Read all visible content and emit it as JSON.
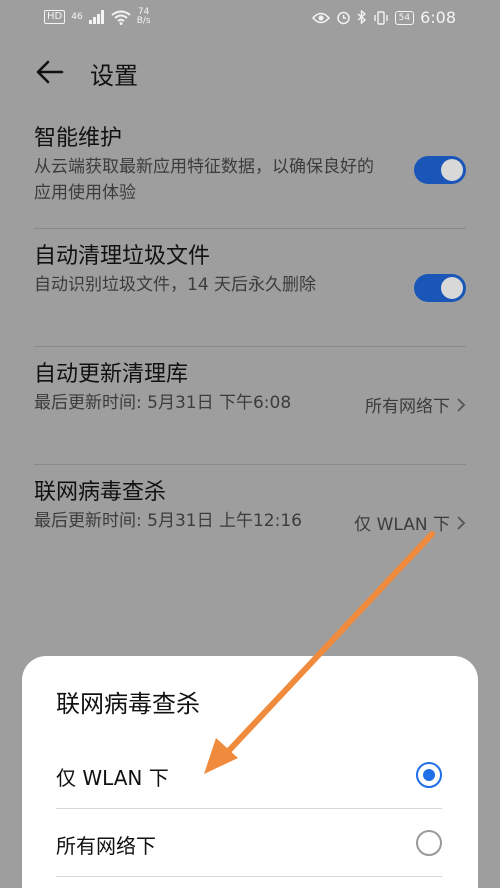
{
  "status_bar": {
    "left_badge": "HD",
    "network": "46",
    "speed_value": "74",
    "speed_unit": "B/s",
    "battery": "54",
    "time": "6:08"
  },
  "header": {
    "title": "设置"
  },
  "items": [
    {
      "title": "智能维护",
      "subtitle": "从云端获取最新应用特征数据，以确保良好的应用使用体验",
      "toggle_on": true
    },
    {
      "title": "自动清理垃圾文件",
      "subtitle": "自动识别垃圾文件，14 天后永久删除",
      "toggle_on": true
    },
    {
      "title": "自动更新清理库",
      "subtitle": "最后更新时间: 5月31日 下午6:08",
      "value": "所有网络下"
    },
    {
      "title": "联网病毒查杀",
      "subtitle": "最后更新时间: 5月31日 上午12:16",
      "value": "仅 WLAN 下"
    }
  ],
  "sheet": {
    "title": "联网病毒查杀",
    "options": [
      {
        "label": "仅 WLAN 下",
        "selected": true
      },
      {
        "label": "所有网络下",
        "selected": false
      }
    ]
  },
  "colors": {
    "toggle_on": "#1a56b8",
    "radio_selected": "#1e6fe8",
    "annotation_arrow": "#f08a3c"
  }
}
